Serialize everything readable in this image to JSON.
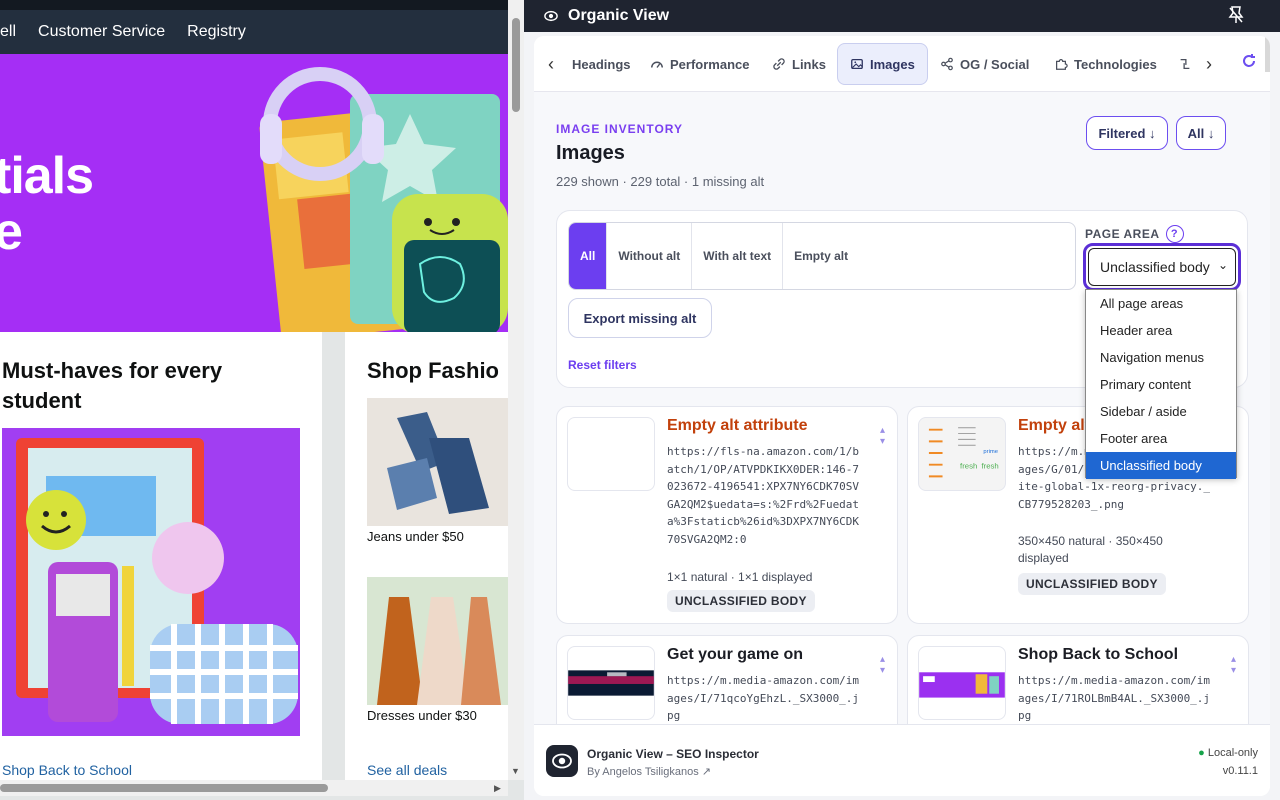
{
  "amazon": {
    "nav": [
      "ell",
      "Customer Service",
      "Registry"
    ],
    "hero_line1": "tials",
    "hero_line2": "e",
    "card1": {
      "title_line1": "Must-haves for every",
      "title_line2": "student",
      "link": "Shop Back to School"
    },
    "card2": {
      "title": "Shop Fashio",
      "cap1": "Jeans under $50",
      "cap2": "Dresses under $30",
      "link": "See all deals"
    }
  },
  "extension": {
    "window_title": "Organic View",
    "tabs": [
      "Headings",
      "Performance",
      "Links",
      "Images",
      "OG / Social",
      "Technologies"
    ],
    "active_tab": "Images",
    "eyebrow": "IMAGE INVENTORY",
    "heading": "Images",
    "summary": "229 shown · 229 total · 1 missing alt",
    "filtered_button": "Filtered ↓",
    "all_button": "All ↓",
    "filters": [
      "All",
      "Without alt",
      "With alt text",
      "Empty alt"
    ],
    "export_button": "Export missing alt",
    "reset_link": "Reset filters",
    "page_area": {
      "label": "PAGE AREA",
      "help": "?",
      "selected": "Unclassified body",
      "options": [
        "All page areas",
        "Header area",
        "Navigation menus",
        "Primary content",
        "Sidebar / aside",
        "Footer area",
        "Unclassified body"
      ]
    },
    "cards": [
      {
        "title": "Empty alt attribute",
        "url": "https://fls-na.amazon.com/1/batch/1/OP/ATVPDKIKX0DER:146-7023672-4196541:XPX7NY6CDK70SVGA2QM2$uedata=s:%2Frd%2Fuedata%3Fstaticb%26id%3DXPX7NY6CDK70SVGA2QM2:0",
        "meta": "1×1 natural · 1×1 displayed",
        "badge": "UNCLASSIFIED BODY"
      },
      {
        "title": "Empty alt attribute",
        "url": "https://m.media-amazon.com/images/G/01/gno/sprites/nav-sprite-global-1x-reorg-privacy._CB779528203_.png",
        "url_display": "https://m.\namazon.com\nprites/nav-sprite-global-1x-\nreorg-\nprivacy._CB779528203_.png",
        "meta": "350×450 natural · 350×450 displayed",
        "badge": "UNCLASSIFIED BODY"
      },
      {
        "title": "Get your game on",
        "url": "https://m.media-amazon.com/images/I/71qcoYgEhzL._SX3000_.jpg"
      },
      {
        "title": "Shop Back to School",
        "url": "https://m.media-amazon.com/images/I/71ROLBmB4AL._SX3000_.jpg"
      }
    ],
    "footer": {
      "title": "Organic View – SEO Inspector",
      "author": "By Angelos Tsiligkanos ↗",
      "status": "Local-only",
      "version": "v0.11.1"
    }
  },
  "colors": {
    "accent": "#6c3ef0",
    "warning": "#c2410c",
    "hero": "#a52ef5",
    "amazon_nav": "#232f3e"
  }
}
